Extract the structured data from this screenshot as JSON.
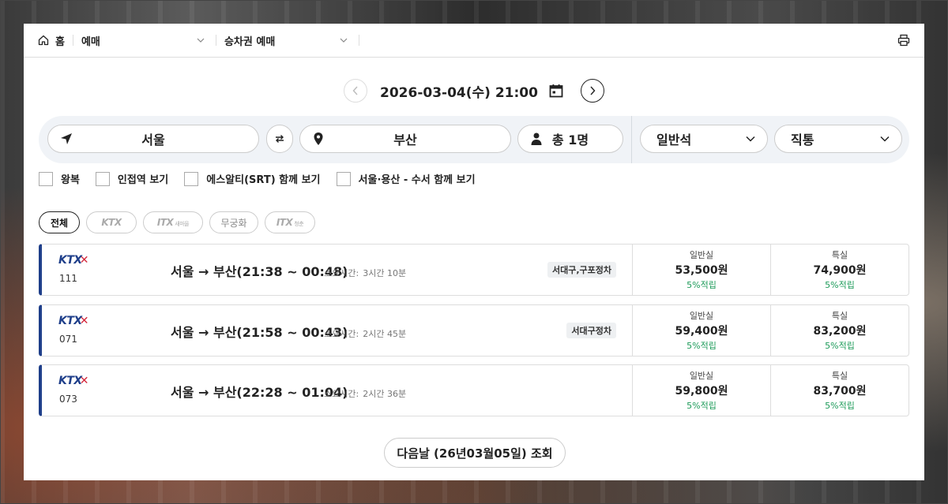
{
  "breadcrumb": {
    "home": "홈",
    "menu1": "예매",
    "menu2": "승차권 예매"
  },
  "date": {
    "text": "2026-03-04(수) 21:00"
  },
  "search": {
    "origin": "서울",
    "destination": "부산",
    "passengers": "총 1명",
    "seat_class": "일반석",
    "route_type": "직통"
  },
  "options": [
    "왕복",
    "인접역 보기",
    "에스알티(SRT) 함께 보기",
    "서울·용산 - 수서 함께 보기"
  ],
  "filters": {
    "all": "전체",
    "ktx": "KTX",
    "itx_saemaeul": "ITX",
    "itx_saemaeul_sub": "새마을",
    "mugunghwa": "무궁화",
    "itx_cheongchun": "ITX",
    "itx_cheongchun_sub": "청춘"
  },
  "trains": [
    {
      "brand": "KTX",
      "number": "111",
      "route": "서울 → 부산(21:38 ~ 00:48)",
      "duration_label": "소요시간:",
      "duration": "3시간 10분",
      "stops": "서대구,구포정차",
      "general": {
        "label": "일반실",
        "price": "53,500원",
        "point": "5%적립"
      },
      "special": {
        "label": "특실",
        "price": "74,900원",
        "point": "5%적립"
      }
    },
    {
      "brand": "KTX",
      "number": "071",
      "route": "서울 → 부산(21:58 ~ 00:43)",
      "duration_label": "소요시간:",
      "duration": "2시간 45분",
      "stops": "서대구정차",
      "general": {
        "label": "일반실",
        "price": "59,400원",
        "point": "5%적립"
      },
      "special": {
        "label": "특실",
        "price": "83,200원",
        "point": "5%적립"
      }
    },
    {
      "brand": "KTX",
      "number": "073",
      "route": "서울 → 부산(22:28 ~ 01:04)",
      "duration_label": "소요시간:",
      "duration": "2시간 36분",
      "stops": "",
      "general": {
        "label": "일반실",
        "price": "59,800원",
        "point": "5%적립"
      },
      "special": {
        "label": "특실",
        "price": "83,700원",
        "point": "5%적립"
      }
    }
  ],
  "next_day_button": "다음날 (26년03월05일) 조회",
  "colors": {
    "ktx_blue": "#1f3f8a",
    "ktx_red": "#d4283d",
    "point_green": "#1e9b5a",
    "search_bg": "#f0f3f7"
  }
}
